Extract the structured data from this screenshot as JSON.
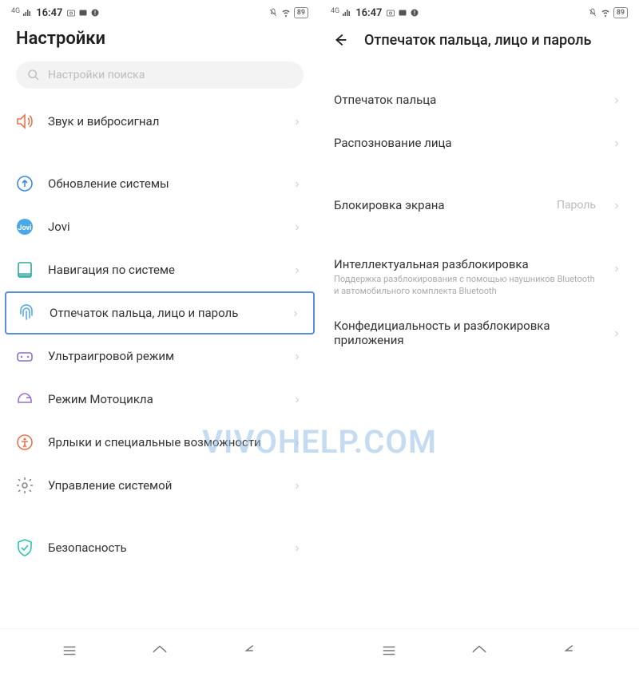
{
  "status": {
    "network": "4G",
    "time": "16:47",
    "battery": "89"
  },
  "left": {
    "title": "Настройки",
    "search_placeholder": "Настройки поиска",
    "items": {
      "sound": "Звук и вибросигнал",
      "update": "Обновление системы",
      "jovi": "Jovi",
      "nav": "Навигация по системе",
      "fingerprint": "Отпечаток пальца, лицо и пароль",
      "game": "Ультраигровой режим",
      "motorcycle": "Режим Мотоцикла",
      "accessibility": "Ярлыки и специальные возможности",
      "sysmgmt": "Управление системой",
      "security": "Безопасность"
    }
  },
  "right": {
    "title": "Отпечаток пальца, лицо и пароль",
    "items": {
      "fingerprint": "Отпечаток пальца",
      "face": "Распознование лица",
      "lockscreen": "Блокировка экрана",
      "lockscreen_value": "Пароль",
      "smart": "Интеллектуальная разблокировка",
      "smart_sub": "Поддержка разблокирования с помощью наушников Bluetooth и автомобильного комплекта Bluetooth",
      "privacy": "Конфедициальность и разблокировка приложения"
    }
  },
  "watermark": "VIVOHELP.COM"
}
